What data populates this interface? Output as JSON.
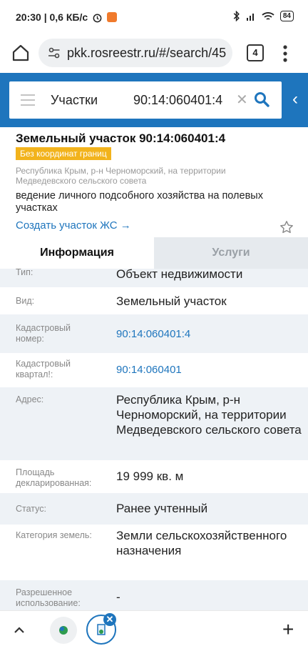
{
  "status_bar": {
    "time_info": "20:30 | 0,6 КБ/с",
    "battery": "84"
  },
  "browser": {
    "url": "pkk.rosreestr.ru/#/search/45",
    "tab_count": "4"
  },
  "search": {
    "type": "Участки",
    "value": "90:14:060401:4"
  },
  "card": {
    "title": "Земельный участок 90:14:060401:4",
    "badge": "Без координат границ",
    "address_short": "Республика Крым, р-н Черноморский, на территории Медведевского сельского совета",
    "purpose": "ведение личного подсобного хозяйства на полевых участках",
    "create_link": "Создать участок ЖС →"
  },
  "tabs": {
    "info": "Информация",
    "services": "Услуги"
  },
  "rows": [
    {
      "label": "Тип:",
      "value": "Объект недвижимости"
    },
    {
      "label": "Вид:",
      "value": "Земельный участок"
    },
    {
      "label": "Кадастровый номер:",
      "value": "90:14:060401:4"
    },
    {
      "label": "Кадастровый квартал!:",
      "value": "90:14:060401"
    },
    {
      "label": "Адрес:",
      "value": "Республика Крым, р-н Черноморский, на территории Медведевского сельского совета"
    },
    {
      "label": "Площадь декларированная:",
      "value": "19 999 кв. м"
    },
    {
      "label": "Статус:",
      "value": "Ранее учтенный"
    },
    {
      "label": "Категория земель:",
      "value": "Земли сельскохозяйственного назначения"
    },
    {
      "label": "Разрешенное использование:",
      "value": "-"
    }
  ],
  "colors": {
    "brand_blue": "#1e75bd",
    "badge_yellow": "#f2b31c"
  }
}
